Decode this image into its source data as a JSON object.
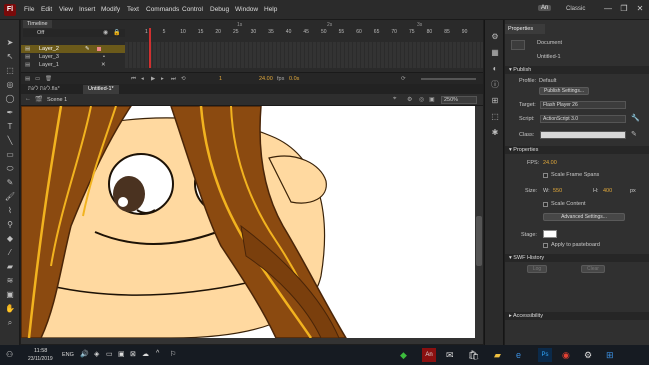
{
  "titlebar": {
    "app_logo": "Fl",
    "menus": [
      "File",
      "Edit",
      "View",
      "Insert",
      "Modify",
      "Text",
      "Commands",
      "Control",
      "Debug",
      "Window",
      "Help"
    ],
    "workspace_icon": "An",
    "workspace": "Classic",
    "window_controls": [
      "—",
      "❐",
      "✕"
    ]
  },
  "timeline": {
    "tab": "Timeline",
    "header_label": "Off",
    "layers": [
      {
        "name": "Layer_2",
        "selected": true
      },
      {
        "name": "Layer_3",
        "selected": false
      },
      {
        "name": "Layer_1",
        "selected": false
      }
    ],
    "frame_numbers": [
      "1",
      "5",
      "10",
      "15",
      "20",
      "25",
      "30",
      "35",
      "40",
      "45",
      "50",
      "55",
      "60",
      "65",
      "70",
      "75",
      "80",
      "85",
      "90"
    ],
    "seconds_marks": [
      "1s",
      "2s",
      "3s"
    ],
    "current_frame": "1",
    "fps": "24.00",
    "fps_unit": "fps",
    "time": "0.0s"
  },
  "doc_tabs": [
    "ליגת ליגת.fla*",
    "Untitled-1*"
  ],
  "scene": {
    "name": "Scene 1",
    "zoom": "250%"
  },
  "properties": {
    "tab": "Properties",
    "doc_type": "Document",
    "doc_name": "Untitled-1",
    "publish": {
      "header": "Publish",
      "profile_label": "Profile:",
      "profile_value": "Default",
      "publish_settings_btn": "Publish Settings...",
      "target_label": "Target:",
      "target_value": "Flash Player 26",
      "script_label": "Script:",
      "script_value": "ActionScript 3.0",
      "class_label": "Class:"
    },
    "props_section": {
      "header": "Properties",
      "fps_label": "FPS:",
      "fps_value": "24.00",
      "scale_frame_spans": "Scale Frame Spans",
      "size_label": "Size:",
      "w_label": "W:",
      "w_value": "550",
      "h_label": "H:",
      "h_value": "400",
      "unit": "px",
      "scale_content": "Scale Content",
      "advanced_btn": "Advanced Settings...",
      "stage_label": "Stage:",
      "apply_pasteboard": "Apply to pasteboard"
    },
    "swf_history": {
      "header": "SWF History",
      "log_btn": "Log",
      "clear_btn": "Clear"
    },
    "accessibility": {
      "header": "Accessibility"
    }
  },
  "taskbar": {
    "time": "11:58",
    "date": "23/11/2019",
    "lang": "ENG"
  },
  "colors": {
    "accent": "#e2a93b",
    "selected_layer": "#6b5a1a",
    "hair": "#8b4a10",
    "hair_dark": "#4a2508",
    "skin": "#ffd9a0"
  }
}
